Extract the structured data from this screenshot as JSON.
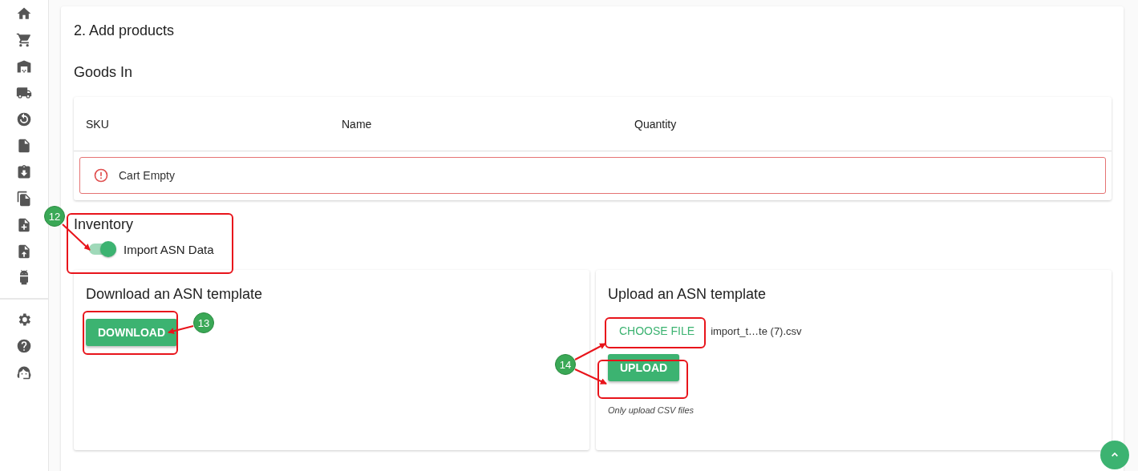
{
  "section_title": "2. Add products",
  "goods_in": {
    "title": "Goods In",
    "columns": [
      "SKU",
      "Name",
      "Quantity"
    ],
    "alert": "Cart Empty"
  },
  "inventory": {
    "title": "Inventory",
    "switch": {
      "label": "Import ASN Data",
      "on": true
    }
  },
  "download_card": {
    "title": "Download an ASN template",
    "button": "DOWNLOAD"
  },
  "upload_card": {
    "title": "Upload an ASN template",
    "choose_button": "CHOOSE FILE",
    "file_name": "import_t…te (7).csv",
    "upload_button": "UPLOAD",
    "hint": "Only upload CSV files"
  },
  "annotations": [
    {
      "label": "12"
    },
    {
      "label": "13"
    },
    {
      "label": "14"
    }
  ]
}
